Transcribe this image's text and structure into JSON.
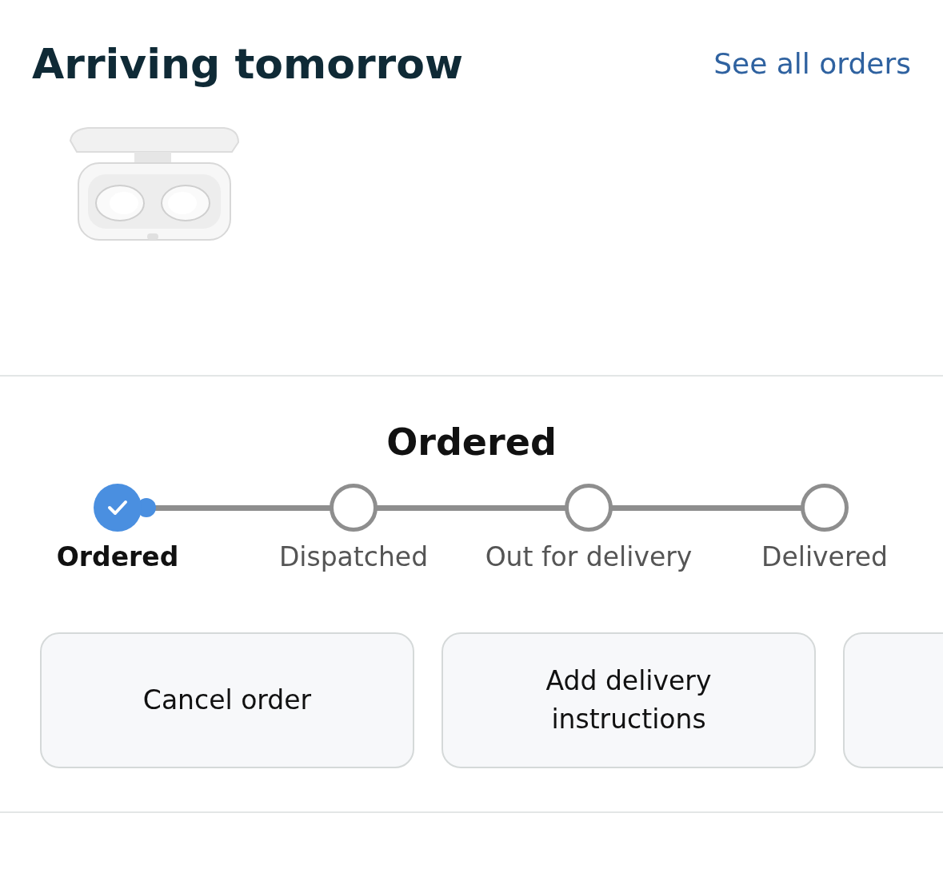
{
  "header": {
    "title": "Arriving tomorrow",
    "link": "See all orders"
  },
  "status": {
    "title": "Ordered"
  },
  "steps": [
    {
      "label": "Ordered",
      "done": true
    },
    {
      "label": "Dispatched",
      "done": false
    },
    {
      "label": "Out for delivery",
      "done": false
    },
    {
      "label": "Delivered",
      "done": false
    }
  ],
  "buttons": [
    {
      "kind": "action",
      "label": "Cancel order"
    },
    {
      "kind": "action",
      "label": "Add delivery instructions"
    },
    {
      "kind": "partial"
    }
  ]
}
